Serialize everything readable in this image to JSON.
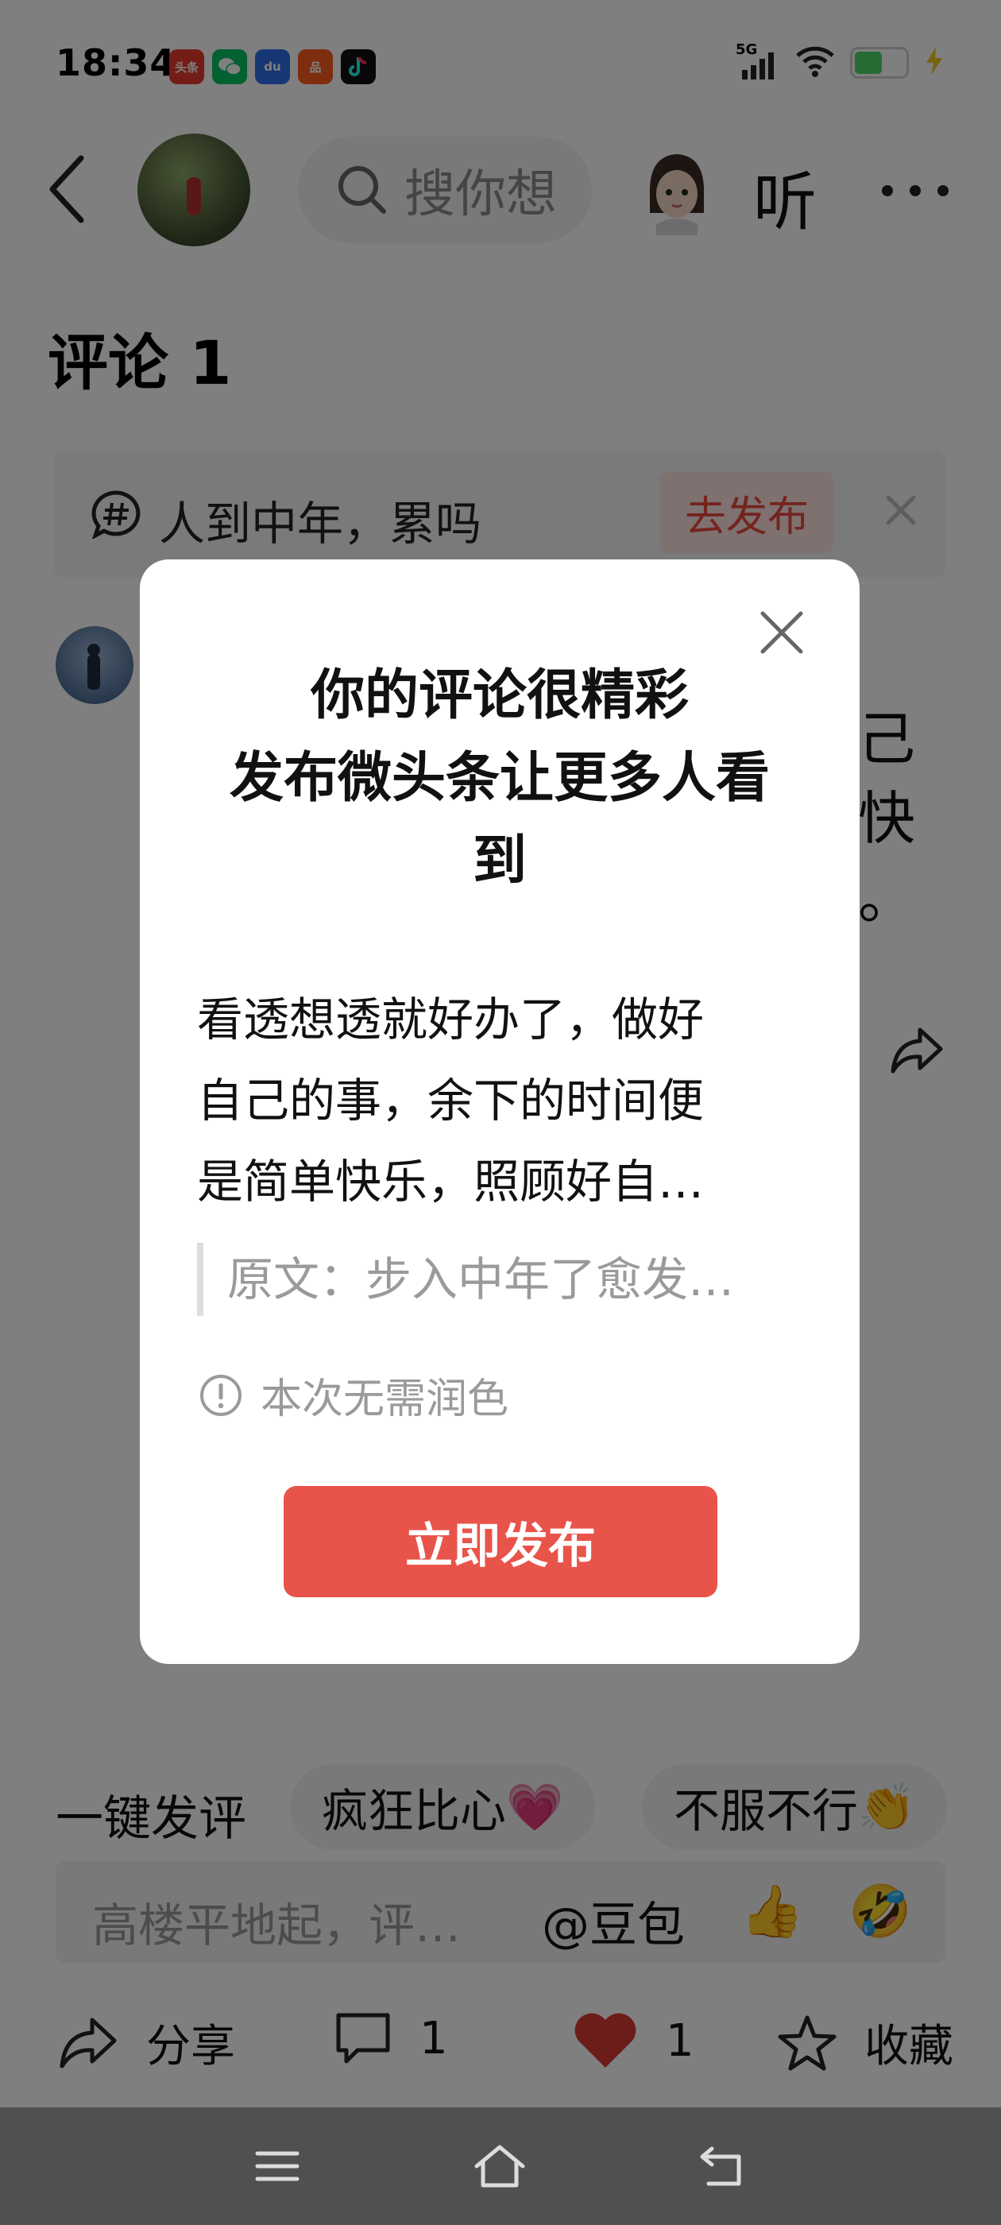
{
  "status_bar": {
    "time": "18:34",
    "apps": [
      {
        "name": "toutiao",
        "label": "头条",
        "color": "#e83a2f"
      },
      {
        "name": "wechat",
        "label": "",
        "color": "#07c160"
      },
      {
        "name": "baidu",
        "label": "du",
        "color": "#2f6ee8"
      },
      {
        "name": "xiaohongshu",
        "label": "品",
        "color": "#ff5a1f"
      },
      {
        "name": "douyin",
        "label": "",
        "color": "#111111"
      }
    ],
    "network": "5G",
    "battery_level": 0.56,
    "charging": true
  },
  "header": {
    "search_placeholder": "搜你想",
    "listen_label": "听"
  },
  "page": {
    "comments_title": "评论 1",
    "topic": {
      "text": "人到中年，累吗",
      "publish_label": "去发布"
    },
    "comment_partial_lines": [
      "己",
      "快",
      "。"
    ]
  },
  "bottom": {
    "quick_label": "一键发评",
    "chips": [
      {
        "text": "疯狂比心",
        "emoji": "💗"
      },
      {
        "text": "不服不行",
        "emoji": "👏"
      }
    ],
    "input_placeholder": "高楼平地起，评…",
    "at_label": "@豆包",
    "emoji_buttons": [
      "👍",
      "🤣"
    ],
    "actions": {
      "share": "分享",
      "comment_count": "1",
      "like_count": "1",
      "favorite": "收藏"
    }
  },
  "modal": {
    "title_lines": [
      "你的评论很精彩",
      "发布微头条让更多人看",
      "到"
    ],
    "body_lines": [
      "看透想透就好办了，做好",
      "自己的事，余下的时间便",
      "是简单快乐，照顾好自…"
    ],
    "quote": "原文：步入中年了愈发…",
    "note": "本次无需润色",
    "publish_button": "立即发布"
  },
  "colors": {
    "accent_red": "#e9544a",
    "like_red": "#d93a32",
    "overlay": "rgba(0,0,0,0.5)"
  }
}
